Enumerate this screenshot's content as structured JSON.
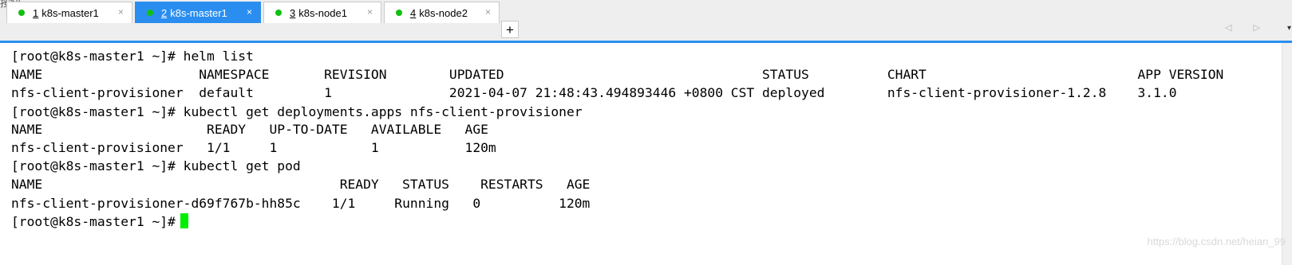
{
  "top_text": "按钮。",
  "tabs": [
    {
      "number": "1",
      "label": "k8s-master1",
      "active": false,
      "close": "×"
    },
    {
      "number": "2",
      "label": "k8s-master1",
      "active": true,
      "close": "×"
    },
    {
      "number": "3",
      "label": "k8s-node1",
      "active": false,
      "close": "×"
    },
    {
      "number": "4",
      "label": "k8s-node2",
      "active": false,
      "close": "×"
    }
  ],
  "add_tab_label": "+",
  "scroll_arrows": "◁ ▷",
  "menu_arrow": "▾",
  "terminal": {
    "lines": [
      "[root@k8s-master1 ~]# helm list",
      "NAME                    NAMESPACE       REVISION        UPDATED                                 STATUS          CHART                           APP VERSION",
      "nfs-client-provisioner  default         1               2021-04-07 21:48:43.494893446 +0800 CST deployed        nfs-client-provisioner-1.2.8    3.1.0",
      "[root@k8s-master1 ~]# kubectl get deployments.apps nfs-client-provisioner",
      "NAME                     READY   UP-TO-DATE   AVAILABLE   AGE",
      "nfs-client-provisioner   1/1     1            1           120m",
      "[root@k8s-master1 ~]# kubectl get pod",
      "NAME                                      READY   STATUS    RESTARTS   AGE",
      "nfs-client-provisioner-d69f767b-hh85c    1/1     Running   0          120m",
      "[root@k8s-master1 ~]# "
    ]
  },
  "watermark": "https://blog.csdn.net/heian_99",
  "colors": {
    "tab_active": "#2a8ef0",
    "status_dot": "#10c010",
    "cursor": "#00ee00",
    "terminal_bg": "#ffffff",
    "terminal_text": "#000000"
  }
}
